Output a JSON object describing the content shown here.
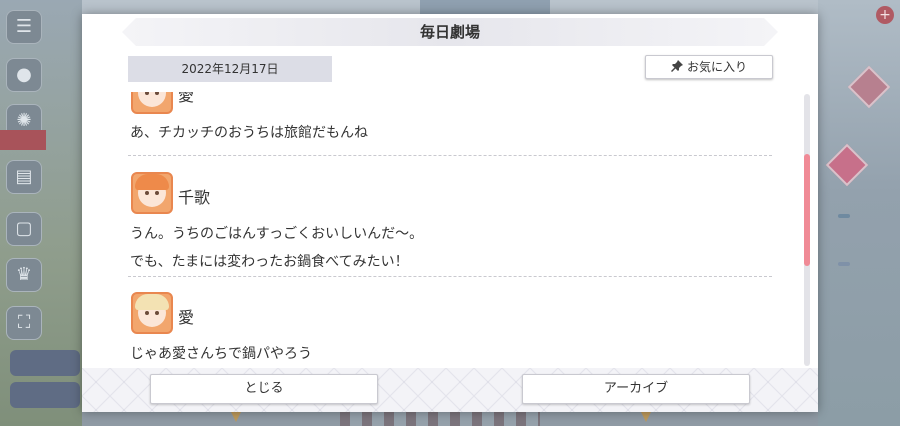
{
  "dialog": {
    "title": "毎日劇場",
    "date": "2022年12月17日",
    "favorite_label": "お気に入り",
    "favorite_icon": "pin-icon"
  },
  "entries": [
    {
      "speaker": "愛",
      "lines": [
        "あ、チカッチのおうちは旅館だもんね"
      ]
    },
    {
      "speaker": "千歌",
      "lines": [
        "うん。うちのごはんすっごくおいしいんだ〜。",
        "でも、たまには変わったお鍋食べてみたい！"
      ]
    },
    {
      "speaker": "愛",
      "lines": [
        "じゃあ愛さんちで鍋パやろう"
      ]
    }
  ],
  "footer": {
    "close_label": "とじる",
    "archive_label": "アーカイブ"
  },
  "colors": {
    "accent_scroll": "#f08a96",
    "avatar_bg": "#f2a66d",
    "hair_ai": "#f3e2b3",
    "hair_chika": "#ee8a4a"
  }
}
